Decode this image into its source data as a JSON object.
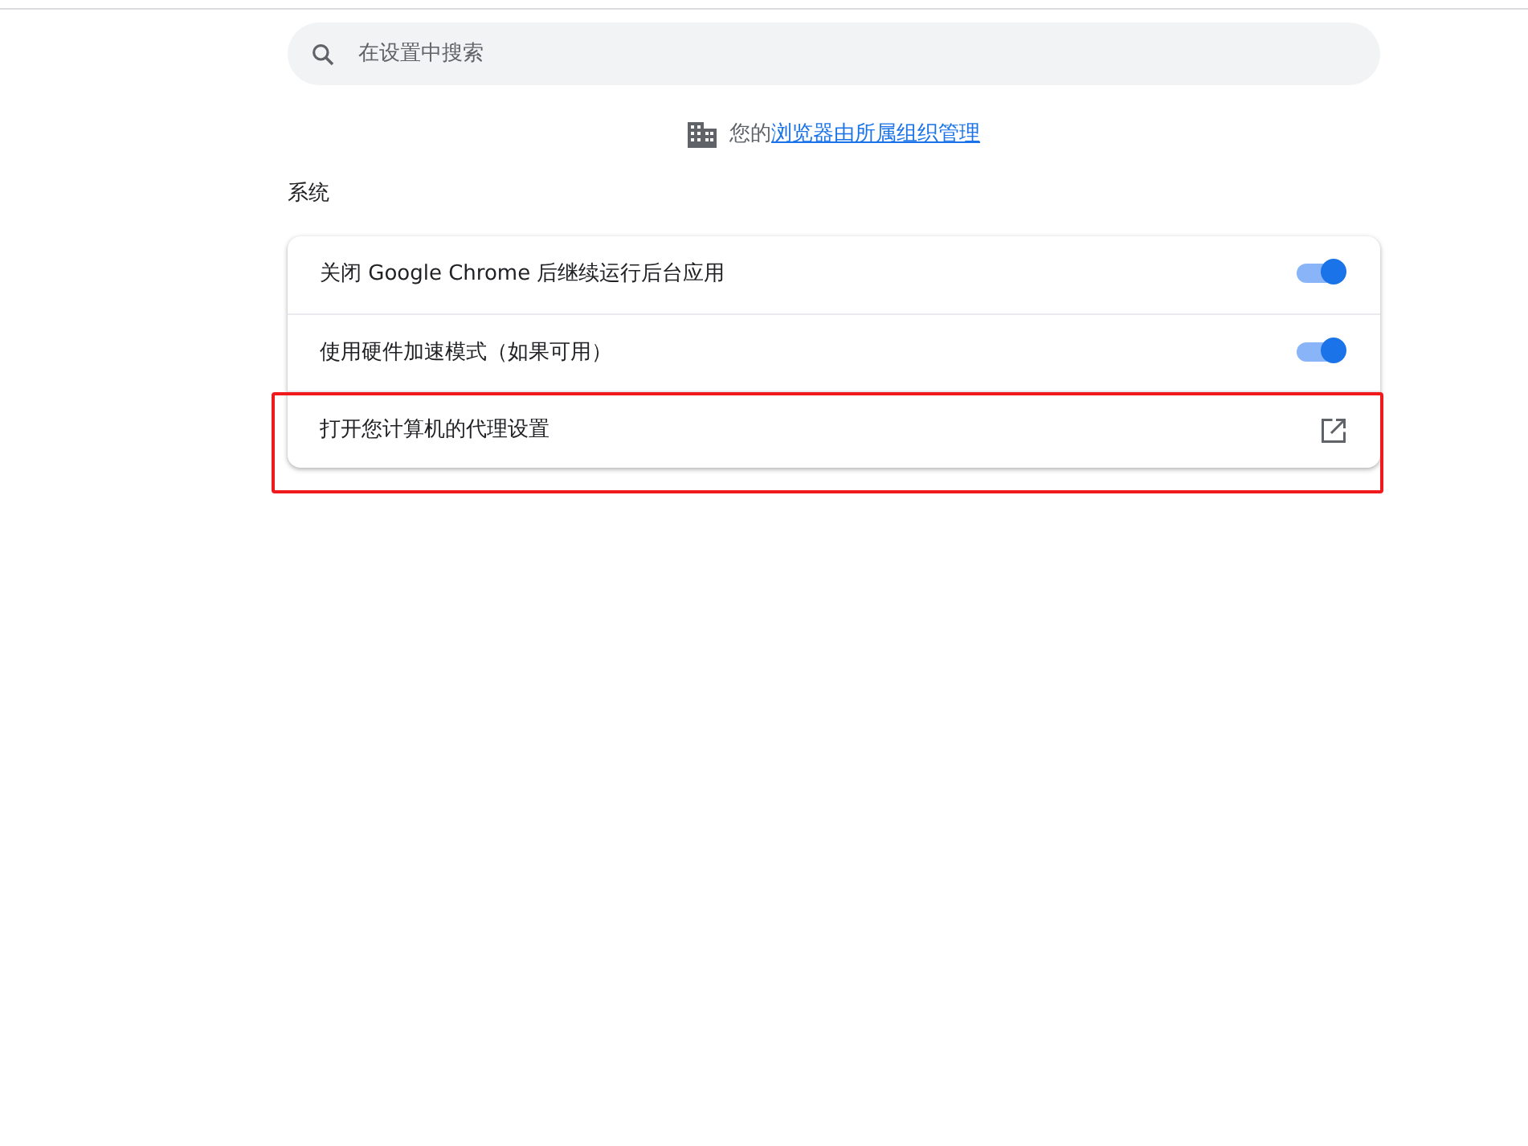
{
  "search": {
    "placeholder": "在设置中搜索"
  },
  "managed_notice": {
    "prefix": "您的",
    "link": "浏览器由所属组织管理"
  },
  "section": {
    "title": "系统"
  },
  "rows": [
    {
      "kind": "toggle",
      "label": "关闭 Google Chrome 后继续运行后台应用",
      "on": true,
      "highlighted": false
    },
    {
      "kind": "toggle",
      "label": "使用硬件加速模式（如果可用）",
      "on": true,
      "highlighted": false
    },
    {
      "kind": "external",
      "label": "打开您计算机的代理设置",
      "highlighted": true
    }
  ]
}
